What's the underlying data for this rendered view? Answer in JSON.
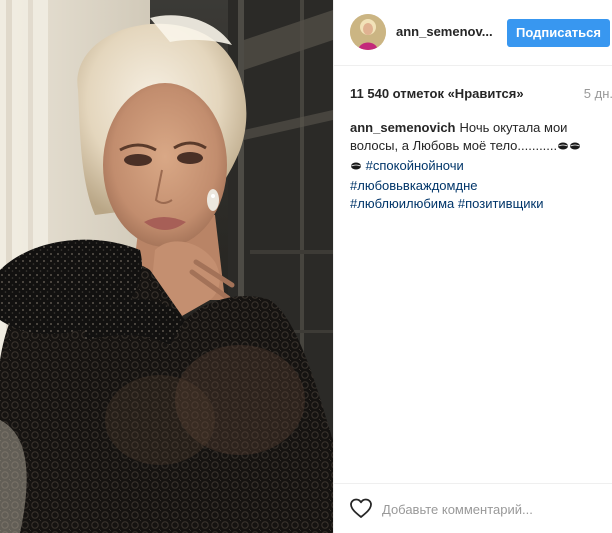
{
  "post": {
    "username": "ann_semenov...",
    "follow_label": "Подписаться",
    "likes": "11 540 отметок «Нравится»",
    "time_ago": "5 дн.",
    "caption": {
      "author": "ann_semenovich",
      "text": "Ночь окутала мои волосы, а Любовь моё тело...........",
      "hashtags": [
        "#спокойнойночи",
        "#любовьвкаждомдне",
        "#люблюилюбима",
        "#позитивщики"
      ]
    },
    "comment_placeholder": "Добавьте комментарий..."
  },
  "icons": {
    "like": "heart-outline-icon",
    "kiss": "kiss-lips-icon",
    "more": "more-options-icon"
  },
  "colors": {
    "follow_button": "#3897f0",
    "hashtag": "#003569",
    "muted": "#999999",
    "text": "#262626"
  }
}
